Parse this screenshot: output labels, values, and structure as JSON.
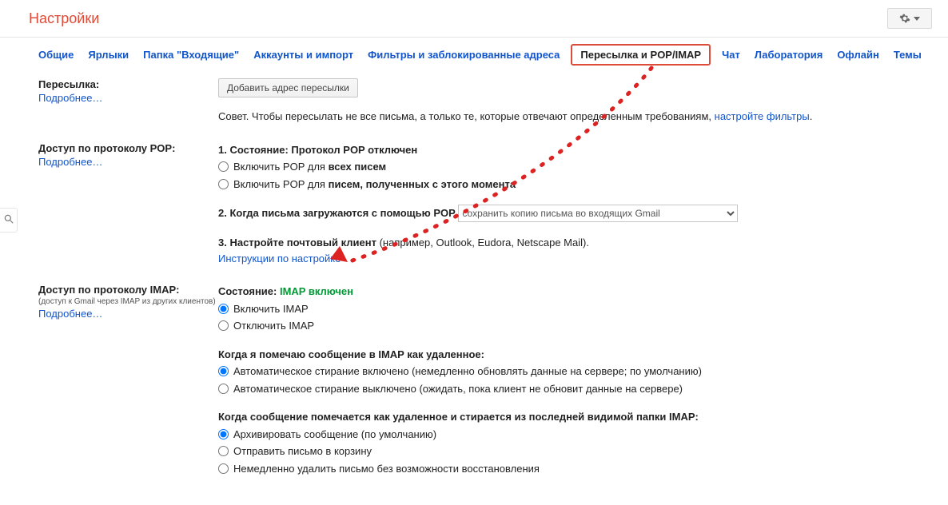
{
  "header": {
    "title": "Настройки"
  },
  "tabs": {
    "general": "Общие",
    "labels": "Ярлыки",
    "inbox": "Папка \"Входящие\"",
    "accounts": "Аккаунты и импорт",
    "filters": "Фильтры и заблокированные адреса",
    "forwarding": "Пересылка и POP/IMAP",
    "chat": "Чат",
    "labs": "Лаборатория",
    "offline": "Офлайн",
    "themes": "Темы"
  },
  "forwarding": {
    "label": "Пересылка:",
    "more": "Подробнее…",
    "add_btn": "Добавить адрес пересылки",
    "hint_prefix": "Совет. Чтобы пересылать не все письма, а только те, которые отвечают определенным требованиям, ",
    "hint_link": "настройте фильтры",
    "hint_suffix": "."
  },
  "pop": {
    "label": "Доступ по протоколу POP:",
    "more": "Подробнее…",
    "status_prefix": "1. Состояние: ",
    "status": "Протокол POP отключен",
    "enable_all_prefix": "Включить POP для ",
    "enable_all_bold": "всех писем",
    "enable_new_prefix": "Включить POP для ",
    "enable_new_bold": "писем, полученных с этого момента",
    "step2": "2. Когда письма загружаются с помощью POP",
    "select_value": "сохранить копию письма во входящих Gmail",
    "step3_bold": "3. Настройте почтовый клиент",
    "step3_rest": " (например, Outlook, Eudora, Netscape Mail).",
    "instr_link": "Инструкции по настройке"
  },
  "imap": {
    "label": "Доступ по протоколу IMAP:",
    "sub": "(доступ к Gmail через IMAP из других клиентов)",
    "more": "Подробнее…",
    "status_prefix": "Состояние: ",
    "status_on": "IMAP включен",
    "enable": "Включить IMAP",
    "disable": "Отключить IMAP",
    "expunge_title": "Когда я помечаю сообщение в IMAP как удаленное:",
    "expunge_on": "Автоматическое стирание включено (немедленно обновлять данные на сервере; по умолчанию)",
    "expunge_off": "Автоматическое стирание выключено (ожидать, пока клиент не обновит данные на сервере)",
    "lastfolder_title": "Когда сообщение помечается как удаленное и стирается из последней видимой папки IMAP:",
    "lf_archive": "Архивировать сообщение (по умолчанию)",
    "lf_trash": "Отправить письмо в корзину",
    "lf_delete": "Немедленно удалить письмо без возможности восстановления"
  }
}
